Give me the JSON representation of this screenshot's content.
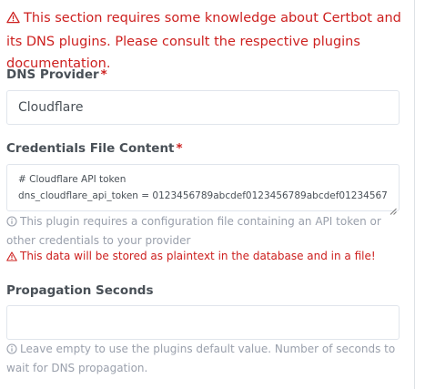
{
  "warning_top": {
    "icon": "warning-triangle-icon",
    "text": "This section requires some knowledge about Certbot and its DNS plugins. Please consult the respective plugins documentation."
  },
  "dns_provider": {
    "label": "DNS Provider",
    "required_mark": "*",
    "value": "Cloudflare"
  },
  "credentials": {
    "label": "Credentials File Content",
    "required_mark": "*",
    "lines": [
      "# Cloudflare API token",
      "dns_cloudflare_api_token = 0123456789abcdef0123456789abcdef01234567"
    ],
    "help_info": "This plugin requires a configuration file containing an API token or other credentials to your provider",
    "help_warning": "This data will be stored as plaintext in the database and in a file!"
  },
  "propagation": {
    "label": "Propagation Seconds",
    "value": "",
    "help_info": "Leave empty to use the plugins default value. Number of seconds to wait for DNS propagation."
  },
  "colors": {
    "danger": "#cd201f",
    "label": "#495057",
    "muted": "#9aa0ac",
    "border": "#e0e5ec"
  }
}
